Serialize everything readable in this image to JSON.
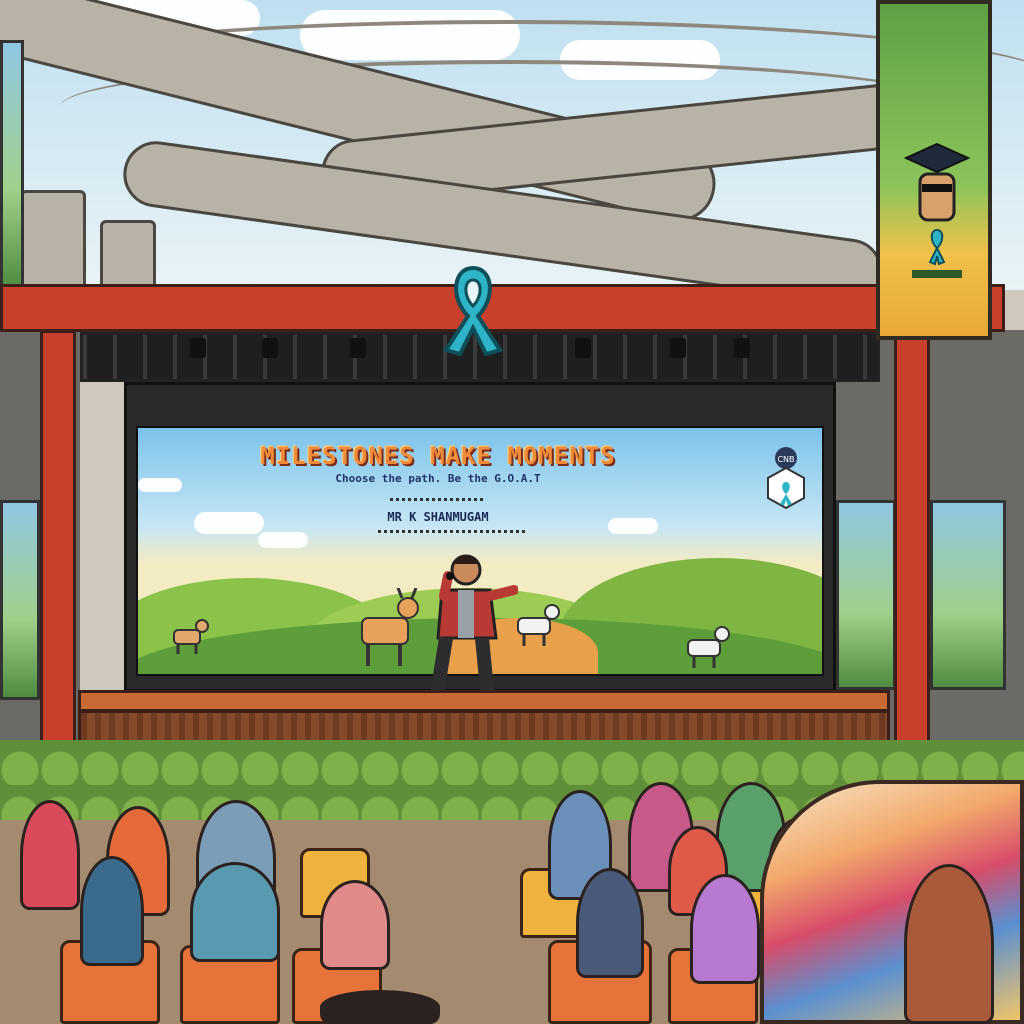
{
  "scene": {
    "screen": {
      "title": "MILESTONES MAKE MOMENTS",
      "subtitle": "Choose the path. Be the G.O.A.T",
      "speaker_name": "MR K SHANMUGAM",
      "badge_text": "CNB"
    },
    "colors": {
      "frame_red": "#c8402c",
      "ribbon_teal": "#2fb3c6",
      "sky_blue": "#7cc3ea",
      "stage_brown": "#c76a35",
      "seat_orange": "#e6733a"
    },
    "icons": [
      "awareness-ribbon-icon",
      "goat-icon",
      "graduation-cap-icon",
      "hexagon-badge-icon"
    ]
  }
}
